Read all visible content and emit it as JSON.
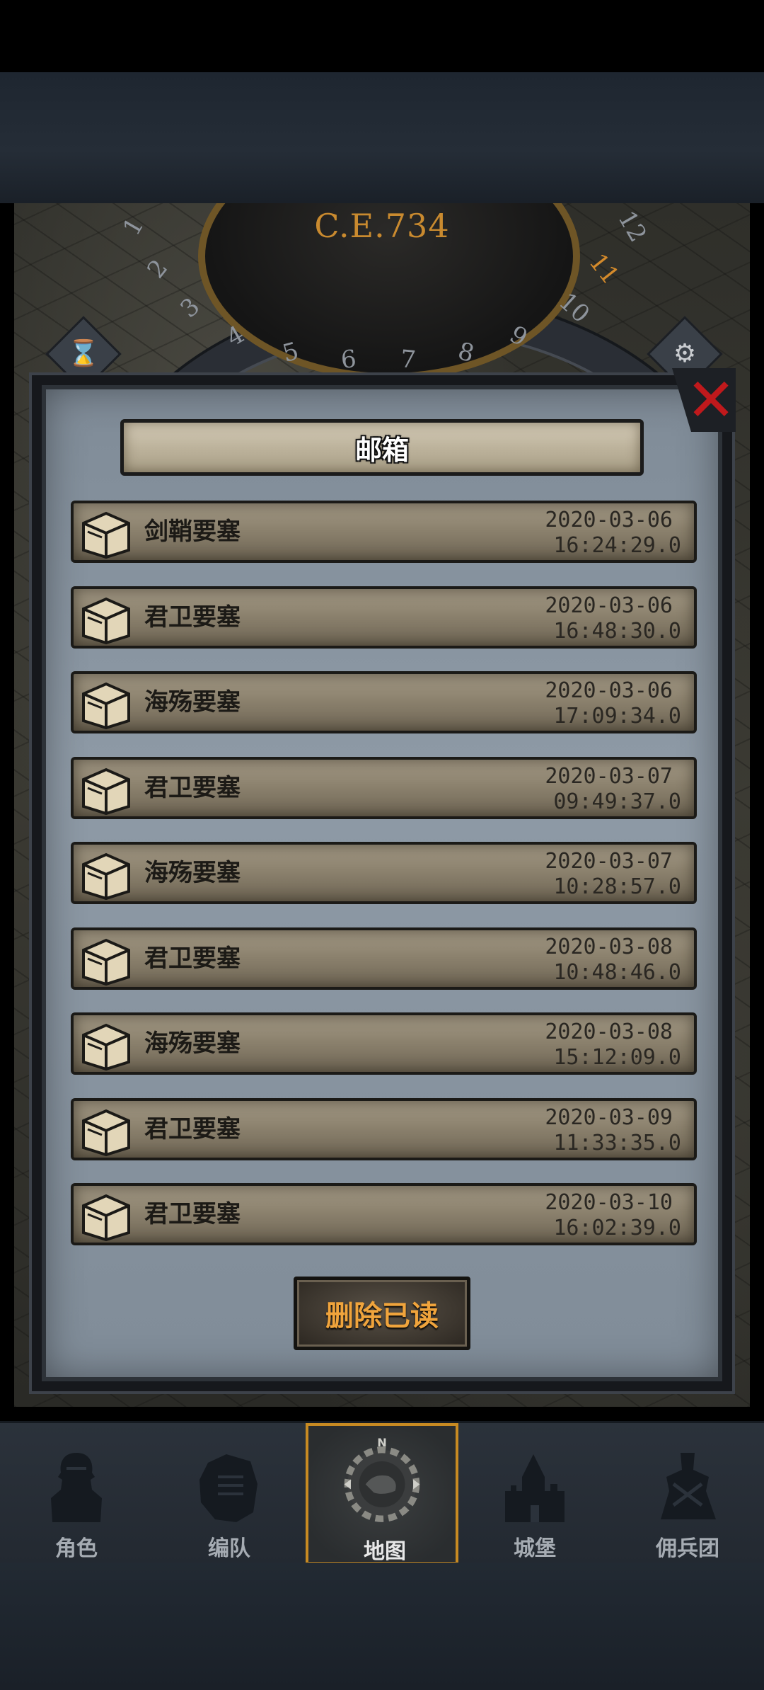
{
  "calendar": {
    "year": "C.E.734",
    "months": [
      "1",
      "2",
      "3",
      "4",
      "5",
      "6",
      "7",
      "8",
      "9",
      "10",
      "11",
      "12"
    ],
    "active_month": "11"
  },
  "mailbox": {
    "title": "邮箱",
    "mails": [
      {
        "name": "剑鞘要塞",
        "date": "2020-03-06",
        "time": "16:24:29.0"
      },
      {
        "name": "君卫要塞",
        "date": "2020-03-06",
        "time": "16:48:30.0"
      },
      {
        "name": "海殇要塞",
        "date": "2020-03-06",
        "time": "17:09:34.0"
      },
      {
        "name": "君卫要塞",
        "date": "2020-03-07",
        "time": "09:49:37.0"
      },
      {
        "name": "海殇要塞",
        "date": "2020-03-07",
        "time": "10:28:57.0"
      },
      {
        "name": "君卫要塞",
        "date": "2020-03-08",
        "time": "10:48:46.0"
      },
      {
        "name": "海殇要塞",
        "date": "2020-03-08",
        "time": "15:12:09.0"
      },
      {
        "name": "君卫要塞",
        "date": "2020-03-09",
        "time": "11:33:35.0"
      },
      {
        "name": "君卫要塞",
        "date": "2020-03-10",
        "time": "16:02:39.0"
      }
    ],
    "delete_read_label": "删除已读",
    "close_icon": "close-x-icon"
  },
  "nav": {
    "items": [
      {
        "label": "角色",
        "icon": "knight-icon"
      },
      {
        "label": "编队",
        "icon": "squad-helmet-icon"
      },
      {
        "label": "地图",
        "icon": "compass-map-icon",
        "active": true
      },
      {
        "label": "城堡",
        "icon": "castle-icon"
      },
      {
        "label": "佣兵团",
        "icon": "mercenary-banner-icon"
      }
    ],
    "compass_letter": "N"
  }
}
